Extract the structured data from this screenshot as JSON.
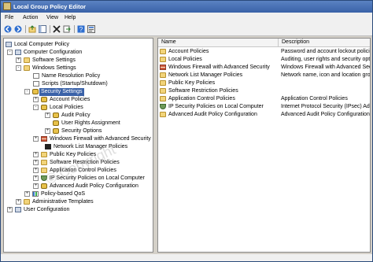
{
  "window": {
    "title": "Local Group Policy Editor"
  },
  "menu": [
    "File",
    "Action",
    "View",
    "Help"
  ],
  "toolbar": [
    "back-icon",
    "forward-icon",
    "up-folder-icon",
    "show-hide-tree-icon",
    "delete-icon",
    "export-icon",
    "help-icon",
    "properties-icon"
  ],
  "tree": [
    {
      "label": "Local Computer Policy",
      "icon": "computer",
      "expander": ""
    },
    {
      "label": "Computer Configuration",
      "icon": "computer",
      "expander": "-"
    },
    {
      "label": "Software Settings",
      "icon": "folder",
      "expander": "+"
    },
    {
      "label": "Windows Settings",
      "icon": "folder",
      "expander": "-"
    },
    {
      "label": "Name Resolution Policy",
      "icon": "doc",
      "expander": ""
    },
    {
      "label": "Scripts (Startup/Shutdown)",
      "icon": "doc",
      "expander": ""
    },
    {
      "label": "Security Settings",
      "icon": "lock",
      "expander": "-",
      "selected": true
    },
    {
      "label": "Account Policies",
      "icon": "lock",
      "expander": "+"
    },
    {
      "label": "Local Policies",
      "icon": "lock",
      "expander": "-"
    },
    {
      "label": "Audit Policy",
      "icon": "lock",
      "expander": "+"
    },
    {
      "label": "User Rights Assignment",
      "icon": "lock",
      "expander": ""
    },
    {
      "label": "Security Options",
      "icon": "lock",
      "expander": "+"
    },
    {
      "label": "Windows Firewall with Advanced Security",
      "icon": "wall",
      "expander": "+"
    },
    {
      "label": "Network List Manager Policies",
      "icon": "doc",
      "expander": ""
    },
    {
      "label": "Public Key Policies",
      "icon": "folder",
      "expander": "+"
    },
    {
      "label": "Software Restriction Policies",
      "icon": "folder",
      "expander": "+"
    },
    {
      "label": "Application Control Policies",
      "icon": "folder",
      "expander": "+"
    },
    {
      "label": "IP Security Policies on Local Computer",
      "icon": "shield",
      "expander": "+"
    },
    {
      "label": "Advanced Audit Policy Configuration",
      "icon": "lock",
      "expander": "+"
    },
    {
      "label": "Policy-based QoS",
      "icon": "chart",
      "expander": "+"
    },
    {
      "label": "Administrative Templates",
      "icon": "folder",
      "expander": "+"
    },
    {
      "label": "User Configuration",
      "icon": "computer",
      "expander": "+"
    }
  ],
  "list": {
    "columns": [
      "Name",
      "Description"
    ],
    "rows": [
      {
        "name": "Account Policies",
        "description": "Password and account lockout policies",
        "icon": "folder"
      },
      {
        "name": "Local Policies",
        "description": "Auditing, user rights and security options",
        "icon": "folder"
      },
      {
        "name": "Windows Firewall with Advanced Security",
        "description": "Windows Firewall with Advanced Security",
        "icon": "wall"
      },
      {
        "name": "Network List Manager Policies",
        "description": "Network name, icon and location group",
        "icon": "folder"
      },
      {
        "name": "Public Key Policies",
        "description": "",
        "icon": "folder"
      },
      {
        "name": "Software Restriction Policies",
        "description": "",
        "icon": "folder"
      },
      {
        "name": "Application Control Policies",
        "description": "Application Control Policies",
        "icon": "folder"
      },
      {
        "name": "IP Security Policies on Local Computer",
        "description": "Internet Protocol Security (IPsec) Admin",
        "icon": "shield"
      },
      {
        "name": "Advanced Audit Policy Configuration",
        "description": "Advanced Audit Policy Configuration",
        "icon": "folder"
      }
    ]
  }
}
